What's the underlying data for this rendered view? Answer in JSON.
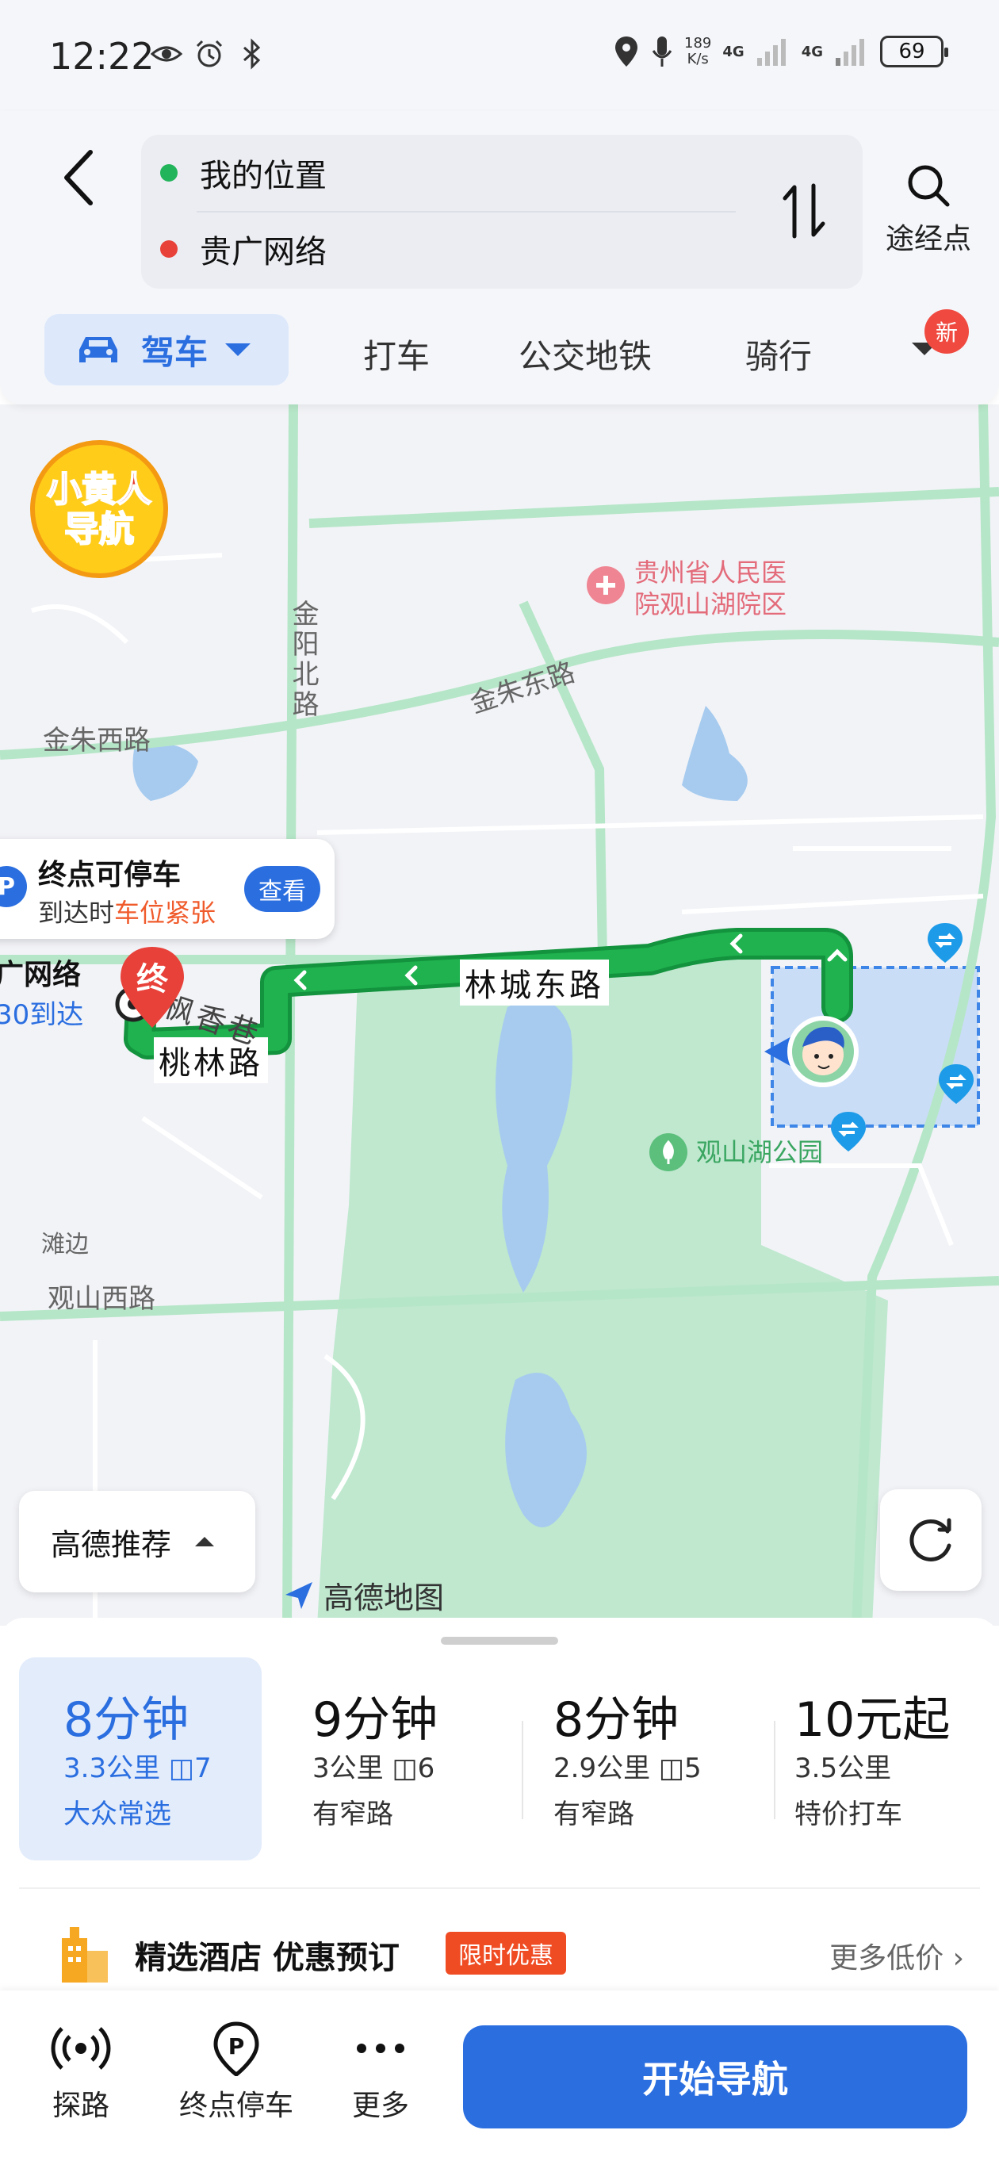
{
  "status_bar": {
    "time": "12:22",
    "net_speed_value": "189",
    "net_speed_unit": "K/s",
    "net_1": "4G",
    "net_2": "4G",
    "battery": "69",
    "icons": [
      "eye-icon",
      "alarm-icon",
      "bluetooth-icon",
      "location-icon",
      "mic-icon",
      "signal-icon",
      "battery-icon"
    ]
  },
  "route": {
    "origin": "我的位置",
    "destination": "贵广网络",
    "origin_color": "#22b45b",
    "destination_color": "#e8413a",
    "waypoint_label": "途经点"
  },
  "modes": {
    "drive": "驾车",
    "taxi": "打车",
    "transit": "公交地铁",
    "bike": "骑行",
    "new_badge": "新"
  },
  "map": {
    "roads": [
      "金阳北路",
      "金朱西路",
      "金朱东路",
      "林城东路",
      "桃林路",
      "枫香巷",
      "观山西路",
      "滩边"
    ],
    "poi_hospital": [
      "贵州省人民医",
      "院观山湖院区"
    ],
    "poi_park": "观山湖公园",
    "brand_badge": [
      "小黄人",
      "导航"
    ],
    "parking_card": {
      "title": "终点可停车",
      "sub_prefix": "到达时",
      "sub_highlight": "车位紧张",
      "button": "查看"
    },
    "dest_pin": "终",
    "dest_label": "广网络",
    "dest_eta": "30到达",
    "recommend": "高德推荐",
    "logo": "高德地图",
    "route_color": "#1fb24f"
  },
  "routes": [
    {
      "time": "8分钟",
      "dist": "3.3公里",
      "lights": "7",
      "tag": "大众常选",
      "active": true
    },
    {
      "time": "9分钟",
      "dist": "3公里",
      "lights": "6",
      "tag": "有窄路"
    },
    {
      "time": "8分钟",
      "dist": "2.9公里",
      "lights": "5",
      "tag": "有窄路"
    },
    {
      "time": "10元起",
      "dist": "3.5公里",
      "lights": "",
      "tag": "特价打车"
    }
  ],
  "hotel": {
    "title": "精选酒店 优惠预订",
    "badge": "限时优惠",
    "more": "更多低价"
  },
  "bottom_bar": {
    "explore": "探路",
    "parking": "终点停车",
    "more": "更多",
    "start": "开始导航"
  },
  "accent_color": "#2a6ee0"
}
